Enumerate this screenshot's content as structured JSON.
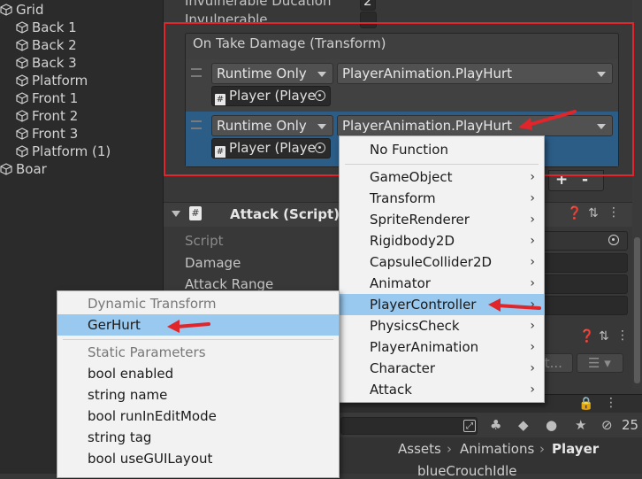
{
  "hierarchy": {
    "items": [
      "Grid",
      "Back 1",
      "Back 2",
      "Back 3",
      "Platform",
      "Front 1",
      "Front 2",
      "Front 3",
      "Platform (1)",
      "Boar"
    ]
  },
  "inspector": {
    "invulnerable_duration_label": "Invulnerable Ducation",
    "invulnerable_duration_value": "2",
    "invulnerable_label": "Invulnerable",
    "event": {
      "title": "On Take Damage (Transform)",
      "rows": [
        {
          "runtime": "Runtime Only",
          "function": "PlayerAnimation.PlayHurt",
          "object": "Player (Playe"
        },
        {
          "runtime": "Runtime Only",
          "function": "PlayerAnimation.PlayHurt",
          "object": "Player (Playe"
        }
      ],
      "add_label": "+",
      "remove_label": "-"
    },
    "attack_component": {
      "title": "Attack (Script)",
      "script_label": "Script",
      "damage_label": "Damage",
      "attack_range_label": "Attack Range"
    },
    "edit_button_label": "dit..."
  },
  "component_menu": {
    "items": [
      {
        "label": "No Function",
        "has_submenu": false,
        "highlighted": false
      },
      {
        "label": "GameObject",
        "has_submenu": true,
        "highlighted": false
      },
      {
        "label": "Transform",
        "has_submenu": true,
        "highlighted": false
      },
      {
        "label": "SpriteRenderer",
        "has_submenu": true,
        "highlighted": false
      },
      {
        "label": "Rigidbody2D",
        "has_submenu": true,
        "highlighted": false
      },
      {
        "label": "CapsuleCollider2D",
        "has_submenu": true,
        "highlighted": false
      },
      {
        "label": "Animator",
        "has_submenu": true,
        "highlighted": false
      },
      {
        "label": "PlayerController",
        "has_submenu": true,
        "highlighted": true
      },
      {
        "label": "PhysicsCheck",
        "has_submenu": true,
        "highlighted": false
      },
      {
        "label": "PlayerAnimation",
        "has_submenu": true,
        "highlighted": false
      },
      {
        "label": "Character",
        "has_submenu": true,
        "highlighted": false
      },
      {
        "label": "Attack",
        "has_submenu": true,
        "highlighted": false
      }
    ]
  },
  "function_submenu": {
    "dynamic_header": "Dynamic Transform",
    "dynamic_items": [
      "GerHurt"
    ],
    "static_header": "Static Parameters",
    "static_items": [
      "bool enabled",
      "string name",
      "bool runInEditMode",
      "string tag",
      "bool useGUILayout"
    ]
  },
  "project": {
    "breadcrumb": [
      "Assets",
      "Animations",
      "Player"
    ],
    "asset_item": "blueCrouchIdle",
    "hidden_count": "25"
  },
  "colors": {
    "highlight": "#99c9ef",
    "annotation_red": "#e0252b"
  }
}
